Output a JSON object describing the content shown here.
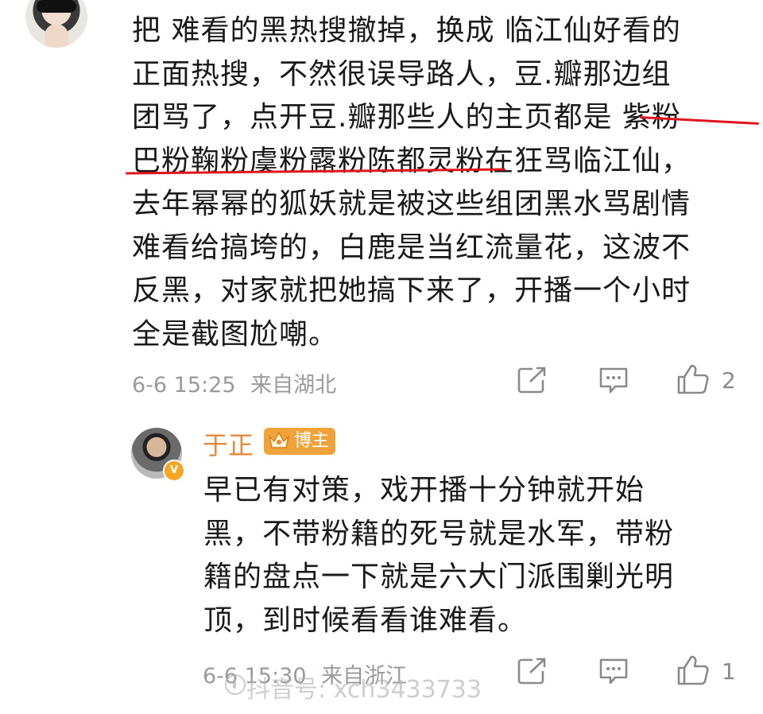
{
  "comment": {
    "lines": [
      "把 难看的黑热搜撤掉，换成 临江仙好看的",
      "正面热搜，不然很误导路人，豆.瓣那边组",
      "团骂了，点开豆.瓣那些人的主页都是 紫粉",
      "巴粉鞠粉虞粉露粉陈都灵粉在狂骂临江仙，",
      "去年幂幂的狐妖就是被这些组团黑水骂剧情",
      "难看给搞垮的，白鹿是当红流量花，这波不",
      "反黑，对家就把她搞下来了，开播一个小时",
      "全是截图尬嘲。"
    ],
    "time": "6-6 15:25",
    "location": "来自湖北",
    "like_count": "2",
    "share_icon": "share-icon",
    "comment_icon": "comment-icon",
    "like_icon": "thumbs-up-icon"
  },
  "reply": {
    "user_name": "于正",
    "badge_label": "博主",
    "lines": [
      "早已有对策，戏开播十分钟就开始",
      "黑，不带粉籍的死号就是水军，带粉",
      "籍的盘点一下就是六大门派围剿光明",
      "顶，到时候看看谁难看。"
    ],
    "time": "6-6 15:30",
    "location": "来自浙江",
    "like_count": "1"
  },
  "watermark": {
    "text": "抖音号: xch3433733"
  },
  "colors": {
    "underline": "#e0141f",
    "name": "#e8883a",
    "badge": "#f0a23b",
    "meta": "#9a9a9a"
  }
}
